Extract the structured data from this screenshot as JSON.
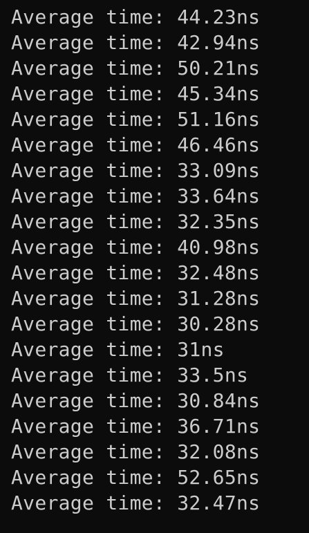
{
  "terminal": {
    "background": "#0c0c0c",
    "foreground": "#cccccc",
    "lines": [
      "Average time: 44.23ns",
      "Average time: 42.94ns",
      "Average time: 50.21ns",
      "Average time: 45.34ns",
      "Average time: 51.16ns",
      "Average time: 46.46ns",
      "Average time: 33.09ns",
      "Average time: 33.64ns",
      "Average time: 32.35ns",
      "Average time: 40.98ns",
      "Average time: 32.48ns",
      "Average time: 31.28ns",
      "Average time: 30.28ns",
      "Average time: 31ns",
      "Average time: 33.5ns",
      "Average time: 30.84ns",
      "Average time: 36.71ns",
      "Average time: 32.08ns",
      "Average time: 52.65ns",
      "Average time: 32.47ns"
    ]
  }
}
